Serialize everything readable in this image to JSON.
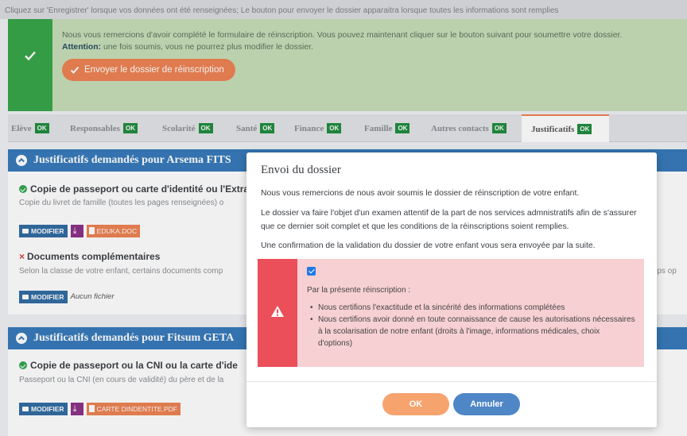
{
  "top_note": "Cliquez sur 'Enregistrer' lorsque vos données ont été renseignées; Le bouton pour envoyer le dossier apparaitra lorsque toutes les informations sont remplies",
  "success": {
    "message": "Nous vous remercions d'avoir complété le formulaire de réinscription. Vous pouvez maintenant cliquer sur le bouton suivant pour soumettre votre dossier.",
    "attention_label": "Attention:",
    "attention_text": " une fois soumis, vous ne pourrez plus modifier le dossier.",
    "send_button": "Envoyer le dossier de réinscription"
  },
  "tabs": [
    {
      "label": "Elève",
      "badge": "OK"
    },
    {
      "label": "Responsables",
      "badge": "OK"
    },
    {
      "label": "Scolarité",
      "badge": "OK"
    },
    {
      "label": "Santé",
      "badge": "OK"
    },
    {
      "label": "Finance",
      "badge": "OK"
    },
    {
      "label": "Famille",
      "badge": "OK"
    },
    {
      "label": "Autres contacts",
      "badge": "OK"
    },
    {
      "label": "Justificatifs",
      "badge": "OK",
      "active": true
    }
  ],
  "sections": [
    {
      "title": "Justificatifs demandés pour Arsema FITS",
      "items": [
        {
          "status": "ok",
          "title": "Copie de passeport ou carte d'identité ou l'Extra",
          "subtitle": "Copie du livret de famille (toutes les pages renseignées) o",
          "modify": "MODIFIER",
          "file": "EDUKA.DOC"
        },
        {
          "status": "missing",
          "title": "Documents complémentaires",
          "subtitle": "Selon la classe de votre enfant, certains documents comp",
          "subtitle_right": "mps op",
          "modify": "MODIFIER",
          "no_file": "Aucun fichier"
        }
      ]
    },
    {
      "title": "Justificatifs demandés pour Fitsum GETA",
      "items": [
        {
          "status": "ok",
          "title": "Copie de passeport ou la CNI ou la carte d'ide",
          "subtitle": "Passeport ou la CNI (en cours de validité) du père et de la",
          "modify": "MODIFIER",
          "file": "CARTE DINDENTITE.PDF"
        }
      ]
    }
  ],
  "modal": {
    "title": "Envoi du dossier",
    "p1": "Nous vous remercions de nous avoir soumis le dossier de réinscription de votre enfant.",
    "p2": "Le dossier va faire l'objet d'un examen attentif de la part de nos services admnistratifs afin de s'assurer que ce dernier soit complet et que les conditions de la réinscriptions soient remplies.",
    "p3": "Une confirmation de la validation du dossier de votre enfant vous sera envoyée par la suite.",
    "checkbox_checked": true,
    "warn_intro": "Par la présente réinscription :",
    "warn_items": [
      "Nous certifions l'exactitude et la sincérité des informations complétées",
      "Nous certifions avoir donné en toute connaissance de cause les autorisations nécessaires à la scolarisation de notre enfant (droits à l'image, informations médicales, choix d'options)"
    ],
    "ok_button": "OK",
    "cancel_button": "Annuler"
  },
  "colors": {
    "accent_orange": "#ed8150",
    "primary_blue": "#3378b9",
    "success_green": "#35a447",
    "danger_red": "#ea4f5a"
  }
}
